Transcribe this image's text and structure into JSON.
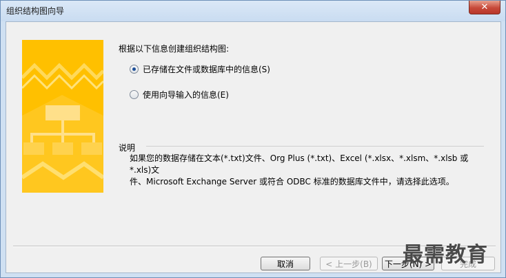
{
  "window": {
    "title": "组织结构图向导",
    "close_glyph": "✕"
  },
  "main": {
    "prompt": "根据以下信息创建组织结构图:",
    "options": [
      {
        "label": "已存储在文件或数据库中的信息(S)",
        "checked": true
      },
      {
        "label": "使用向导输入的信息(E)",
        "checked": false
      }
    ],
    "description_title": "说明",
    "description_lines": [
      "如果您的数据存储在文本(*.txt)文件、Org Plus (*.txt)、Excel (*.xlsx、*.xlsm、*.xlsb 或 *.xls)文",
      "件、Microsoft Exchange Server 或符合 ODBC 标准的数据库文件中，请选择此选项。"
    ]
  },
  "buttons": {
    "cancel": "取消",
    "back": "< 上一步(B)",
    "next": "下一步(N) >",
    "finish": "完成"
  },
  "watermark": "最需教育",
  "colors": {
    "accent": "#ffc000",
    "radio_dot": "#1d4f99"
  }
}
